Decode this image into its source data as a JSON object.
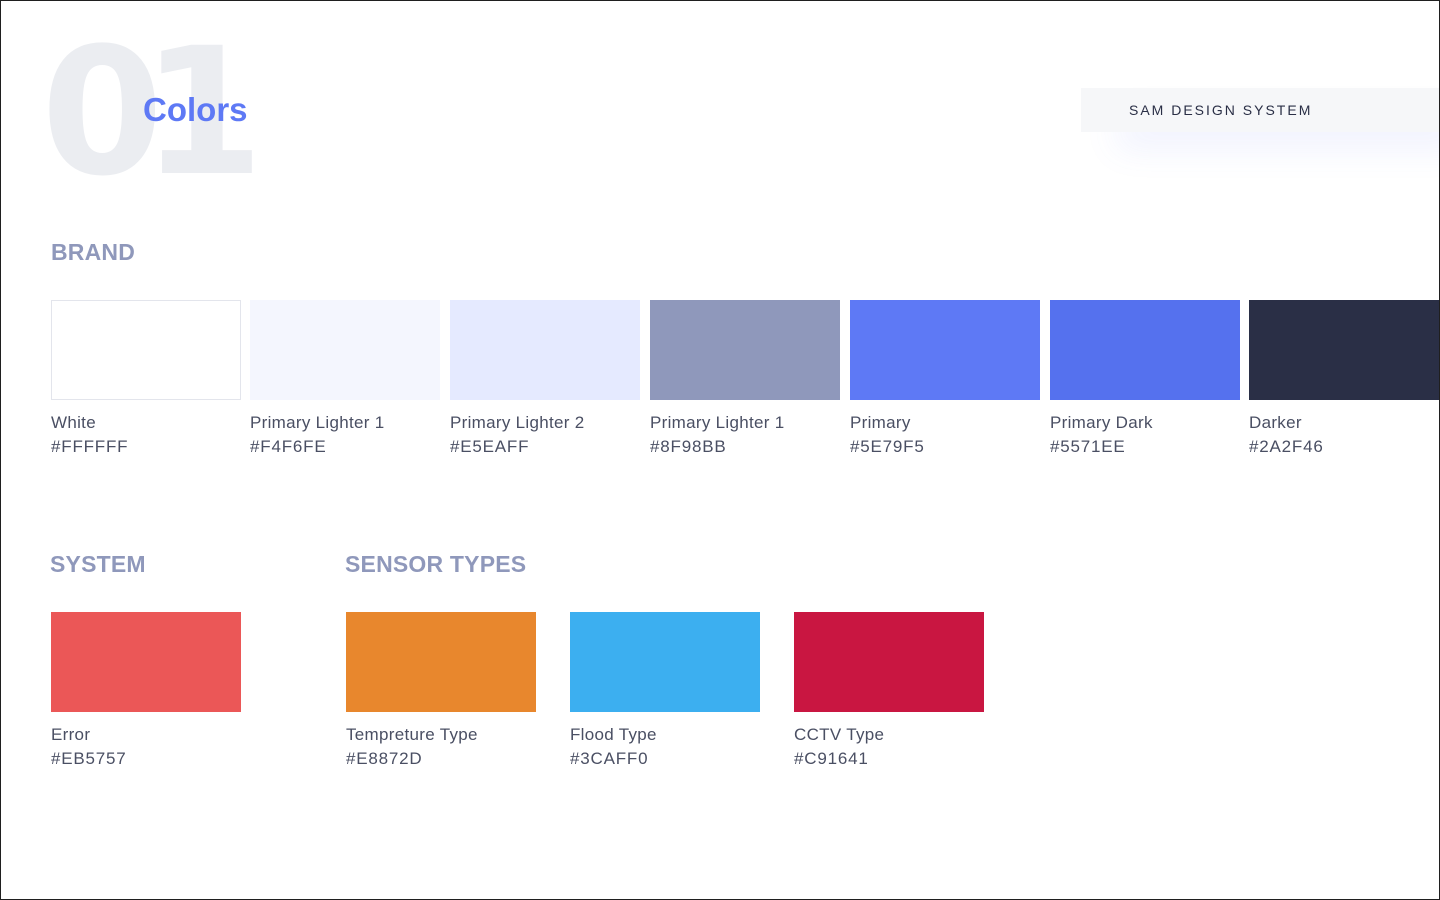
{
  "header": {
    "number": "01",
    "title": "Colors",
    "badge": "SAM DESIGN SYSTEM"
  },
  "sections": {
    "brand": {
      "heading": "BRAND",
      "swatches": [
        {
          "name": "White",
          "hex": "#FFFFFF",
          "color": "#FFFFFF"
        },
        {
          "name": "Primary Lighter 1",
          "hex": "#F4F6FE",
          "color": "#F4F6FE"
        },
        {
          "name": "Primary Lighter 2",
          "hex": "#E5EAFF",
          "color": "#E5EAFF"
        },
        {
          "name": "Primary Lighter 1",
          "hex": "#8F98BB",
          "color": "#8F98BB"
        },
        {
          "name": "Primary",
          "hex": "#5E79F5",
          "color": "#5E79F5"
        },
        {
          "name": "Primary Dark",
          "hex": "#5571EE",
          "color": "#5571EE"
        },
        {
          "name": "Darker",
          "hex": "#2A2F46",
          "color": "#2A2F46"
        }
      ]
    },
    "system": {
      "heading": "SYSTEM",
      "swatches": [
        {
          "name": "Error",
          "hex": "#EB5757",
          "color": "#EB5757"
        }
      ]
    },
    "sensor": {
      "heading": "SENSOR TYPES",
      "swatches": [
        {
          "name": "Tempreture Type",
          "hex": "#E8872D",
          "color": "#E8872D"
        },
        {
          "name": "Flood Type",
          "hex": "#3CAFF0",
          "color": "#3CAFF0"
        },
        {
          "name": "CCTV Type",
          "hex": "#C91641",
          "color": "#C91641"
        }
      ]
    }
  }
}
